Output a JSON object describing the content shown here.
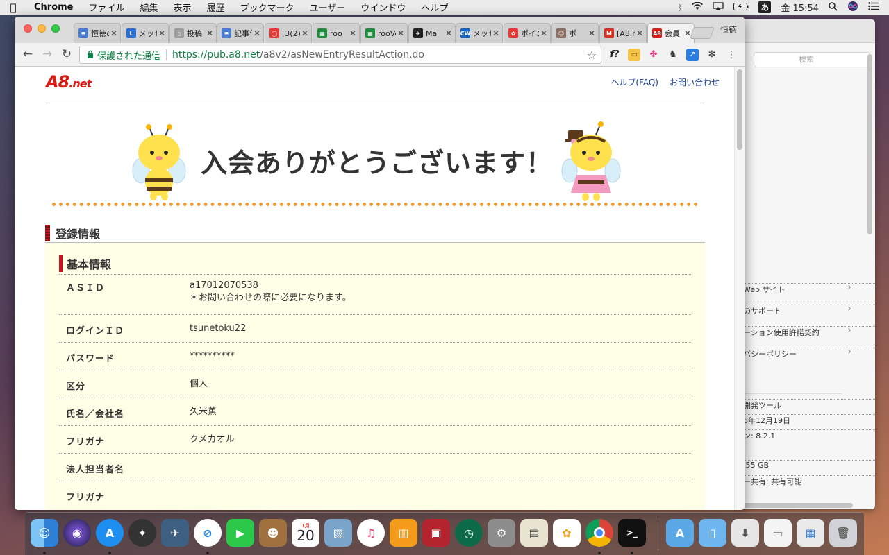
{
  "menubar": {
    "app_name": "Chrome",
    "items": [
      "ファイル",
      "編集",
      "表示",
      "履歴",
      "ブックマーク",
      "ユーザー",
      "ウインドウ",
      "ヘルプ"
    ],
    "ime": "あ",
    "clock": "金 15:54"
  },
  "background_window": {
    "profile_label": "恒徳",
    "search_placeholder": "検索",
    "links": [
      "Web サイト",
      "のサポート",
      "ーション使用許諾契約",
      "バシーポリシー"
    ],
    "info": [
      "開発ツール",
      "6年12月19日",
      "ン: 8.2.1",
      ".55 GB",
      "ー共有: 共有可能"
    ]
  },
  "tabs": [
    {
      "title": "恒徳の",
      "icon": "docs-icon",
      "color": "#4a7bd6",
      "glyph": "≡"
    },
    {
      "title": "メッセ",
      "icon": "l-app-icon",
      "color": "#2a6fd6",
      "glyph": "L"
    },
    {
      "title": "投稿",
      "icon": "page-icon",
      "color": "#9e9e9e",
      "glyph": "▯"
    },
    {
      "title": "記事作",
      "icon": "docs-icon",
      "color": "#4a7bd6",
      "glyph": "≡"
    },
    {
      "title": "[3(2)]",
      "icon": "chat-icon",
      "color": "#e53935",
      "glyph": "◯"
    },
    {
      "title": "roo",
      "icon": "sheets-icon",
      "color": "#1e8e3e",
      "glyph": "▦"
    },
    {
      "title": "rooVe",
      "icon": "sheets-icon",
      "color": "#1e8e3e",
      "glyph": "▦"
    },
    {
      "title": "Ma",
      "icon": "bird-icon",
      "color": "#222222",
      "glyph": "✈"
    },
    {
      "title": "メッセ",
      "icon": "chatwork-icon",
      "color": "#1565c0",
      "glyph": "CW"
    },
    {
      "title": "ポイン",
      "icon": "point-icon",
      "color": "#e53935",
      "glyph": "✿"
    },
    {
      "title": "ポ",
      "icon": "face-icon",
      "color": "#8d6e63",
      "glyph": "☺"
    },
    {
      "title": "[A8.n",
      "icon": "gmail-icon",
      "color": "#d93025",
      "glyph": "M"
    },
    {
      "title": "会員",
      "icon": "a8-icon",
      "color": "#d91e18",
      "glyph": "A8"
    }
  ],
  "active_tab_index": 12,
  "profile_name": "恒徳",
  "address": {
    "secure_label": "保護された通信",
    "host": "https://pub.a8.net",
    "path": "/a8v2/asNewEntryResultAction.do"
  },
  "page": {
    "logo_main": "A8",
    "logo_sub": ".net",
    "help_link": "ヘルプ(FAQ)",
    "contact_link": "お問い合わせ",
    "banner_text": "入会ありがとうございます！",
    "section_title": "登録情報",
    "subsection_title": "基本情報",
    "rows": [
      {
        "label": "ＡＳＩＤ",
        "value": "a17012070538",
        "note": "＊お問い合わせの際に必要になります。"
      },
      {
        "label": "ログインＩＤ",
        "value": "tsunetoku22",
        "note": ""
      },
      {
        "label": "パスワード",
        "value": "**********",
        "note": ""
      },
      {
        "label": "区分",
        "value": "個人",
        "note": ""
      },
      {
        "label": "氏名／会社名",
        "value": "久米薫",
        "note": ""
      },
      {
        "label": "フリガナ",
        "value": "クメカオル",
        "note": ""
      },
      {
        "label": "法人担当者名",
        "value": "",
        "note": ""
      },
      {
        "label": "フリガナ",
        "value": "",
        "note": ""
      }
    ]
  },
  "dock": {
    "calendar_month": "1月",
    "calendar_day": "20"
  }
}
